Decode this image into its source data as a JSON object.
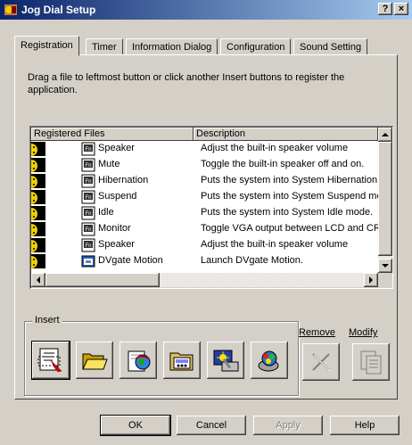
{
  "window": {
    "title": "Jog Dial Setup",
    "help_button": "?",
    "close_button": "×"
  },
  "tabs": [
    {
      "label": "Registration",
      "active": true
    },
    {
      "label": "Timer",
      "active": false
    },
    {
      "label": "Information Dialog",
      "active": false
    },
    {
      "label": "Configuration",
      "active": false
    },
    {
      "label": "Sound Setting",
      "active": false
    }
  ],
  "registration": {
    "instructions": "Drag a file to leftmost button or click another Insert buttons to register the application.",
    "columns": {
      "files": "Registered Files",
      "description": "Description"
    },
    "rows": [
      {
        "name": "Speaker",
        "description": "Adjust the built-in speaker volume",
        "icon": "fn-key-icon"
      },
      {
        "name": "Mute",
        "description": "Toggle the built-in speaker off and on.",
        "icon": "fn-key-icon"
      },
      {
        "name": "Hibernation",
        "description": "Puts the system into System Hibernation",
        "icon": "fn-key-icon"
      },
      {
        "name": "Suspend",
        "description": "Puts the system into System Suspend mode",
        "icon": "fn-key-icon"
      },
      {
        "name": "Idle",
        "description": "Puts the system into System Idle mode.",
        "icon": "fn-key-icon"
      },
      {
        "name": "Monitor",
        "description": "Toggle VGA output between LCD and CRT",
        "icon": "fn-key-icon"
      },
      {
        "name": "Speaker",
        "description": "Adjust the built-in speaker volume",
        "icon": "fn-key-icon"
      },
      {
        "name": "DVgate Motion",
        "description": "Launch DVgate Motion.",
        "icon": "application-icon"
      }
    ]
  },
  "insert": {
    "group_label": "Insert",
    "buttons": [
      {
        "name": "insert-file-button",
        "icon": "document-pointer-icon"
      },
      {
        "name": "insert-folder-button",
        "icon": "folder-open-icon"
      },
      {
        "name": "insert-web-button",
        "icon": "internet-icon"
      },
      {
        "name": "insert-audio-button",
        "icon": "audio-player-icon"
      },
      {
        "name": "insert-settings-button",
        "icon": "settings-icon"
      },
      {
        "name": "insert-tools-button",
        "icon": "tools-icon"
      }
    ]
  },
  "actions": {
    "remove_label": "Remove",
    "modify_label": "Modify"
  },
  "dialog_buttons": {
    "ok": "OK",
    "cancel": "Cancel",
    "apply": "Apply",
    "help": "Help"
  },
  "colors": {
    "title_gradient_start": "#0a246a",
    "title_gradient_end": "#a6caf0",
    "face": "#d4d0c8"
  }
}
